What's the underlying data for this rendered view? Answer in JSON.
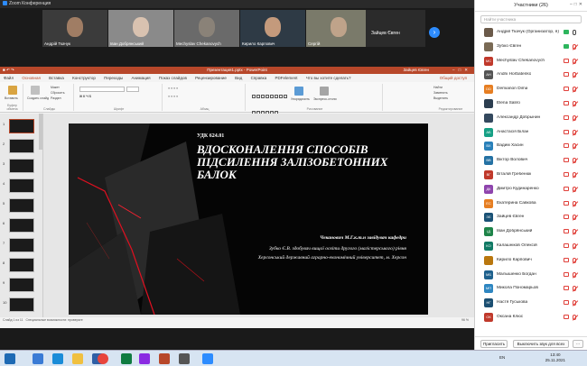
{
  "zoom": {
    "window_title": "Zoom Конференция"
  },
  "videos": [
    {
      "name": "Андрій Ткачук"
    },
    {
      "name": "Іван Добрянський"
    },
    {
      "name": "Mechyslav Chekanovych"
    },
    {
      "name": "Кирило Карпович"
    },
    {
      "name": "Сергій"
    },
    {
      "name": "Зайцев Євген"
    }
  ],
  "ppt": {
    "title": "Презентация1.pptx  -  PowerPoint",
    "user": "Зайцев Євген",
    "tabs": [
      "Файл",
      "Основная",
      "Вставка",
      "Конструктор",
      "Переходы",
      "Анимация",
      "Показ слайдов",
      "Рецензирование",
      "Вид",
      "Справка",
      "PDFelement",
      "Что вы хотите сделать?"
    ],
    "active_tab": "Основная",
    "share": "Общий доступ",
    "ribbon_groups": [
      "Буфер обмена",
      "Слайды",
      "Шрифт",
      "Абзац",
      "Рисование",
      "Редактирование"
    ],
    "ribbon_buttons": {
      "paste": "Вставить",
      "create_slide": "Создать слайд",
      "layout": "Макет",
      "reset": "Сбросить",
      "section": "Раздел",
      "arrange": "Упорядочить",
      "quick_styles": "Экспресс-стили",
      "find": "Найти",
      "replace": "Заменить",
      "select": "Выделить"
    },
    "status_left": "Слайд 1 из 11",
    "status_lang": "Специальные возможности: проверьте",
    "zoom": "96 %"
  },
  "slide": {
    "udc": "УДК 624.01",
    "title": "ВДОСКОНАЛЕННЯ СПОСОБІВ ПІДСИЛЕННЯ ЗАЛІЗОБЕТОННИХ БАЛОК",
    "author1": "Чеканович М.Г.к.т.н завідувач кафедри",
    "author2": "Зубко Є.В. здобувач вищої освіти другого (магістерського) рівня",
    "author3": "Херсонський державний аграрно-економічний університет, м. Херсон"
  },
  "panel": {
    "title": "Участники (26)",
    "search_placeholder": "Найти участника",
    "invite": "Пригласить",
    "mute_all": "Выключить звук для всех",
    "participants": [
      {
        "name": "Андрій Ткачук (Организатор, я)",
        "initials": "",
        "color": "#6b5a4a",
        "cam": true,
        "mic": true
      },
      {
        "name": "Зубко Євген",
        "initials": "",
        "color": "#7a6a55",
        "cam": true,
        "mic": false
      },
      {
        "name": "Mechyslav Chekanovych",
        "initials": "MC",
        "color": "#c0392b",
        "cam": false,
        "mic": false
      },
      {
        "name": "Andrii Horbatenko",
        "initials": "AH",
        "color": "#555555",
        "cam": false,
        "mic": false
      },
      {
        "name": "Demianon Dima",
        "initials": "DD",
        "color": "#e67e22",
        "cam": false,
        "mic": false
      },
      {
        "name": "Elena Saliro",
        "initials": "",
        "color": "#2c3e50",
        "cam": false,
        "mic": false
      },
      {
        "name": "Александр Добрынин",
        "initials": "",
        "color": "#34495e",
        "cam": false,
        "mic": false
      },
      {
        "name": "Анастасія Білан",
        "initials": "АБ",
        "color": "#16a085",
        "cam": false,
        "mic": false
      },
      {
        "name": "Вадим Хасин",
        "initials": "ВХ",
        "color": "#2980b9",
        "cam": false,
        "mic": false
      },
      {
        "name": "Віктор Волович",
        "initials": "ВВ",
        "color": "#2471a3",
        "cam": false,
        "mic": false
      },
      {
        "name": "Віталій Гребенюк",
        "initials": "ВГ",
        "color": "#c0392b",
        "cam": false,
        "mic": false
      },
      {
        "name": "Дмитро Кудинаренко",
        "initials": "ДК",
        "color": "#8e44ad",
        "cam": false,
        "mic": false
      },
      {
        "name": "Екатерина Савкова",
        "initials": "ЕС",
        "color": "#e67e22",
        "cam": false,
        "mic": false
      },
      {
        "name": "Зайцев Євген",
        "initials": "ЗЄ",
        "color": "#1a5276",
        "cam": false,
        "mic": false
      },
      {
        "name": "Іван Добрянський",
        "initials": "ІД",
        "color": "#1e8449",
        "cam": false,
        "mic": false
      },
      {
        "name": "Калашніков Олексій",
        "initials": "КО",
        "color": "#117a65",
        "cam": false,
        "mic": false
      },
      {
        "name": "Кирило Карпович",
        "initials": "",
        "color": "#b9770e",
        "cam": false,
        "mic": false
      },
      {
        "name": "Малышенко Богдан",
        "initials": "МБ",
        "color": "#1f618d",
        "cam": false,
        "mic": false
      },
      {
        "name": "Микола Пономарьов",
        "initials": "МП",
        "color": "#2e86c1",
        "cam": false,
        "mic": false
      },
      {
        "name": "Настя Гуськова",
        "initials": "НГ",
        "color": "#1b4f72",
        "cam": false,
        "mic": false
      },
      {
        "name": "Оксана Клюс",
        "initials": "ОК",
        "color": "#c0392b",
        "cam": false,
        "mic": false
      }
    ]
  },
  "taskbar": {
    "lang": "EN",
    "time": "13:40",
    "date": "25.11.2021"
  }
}
